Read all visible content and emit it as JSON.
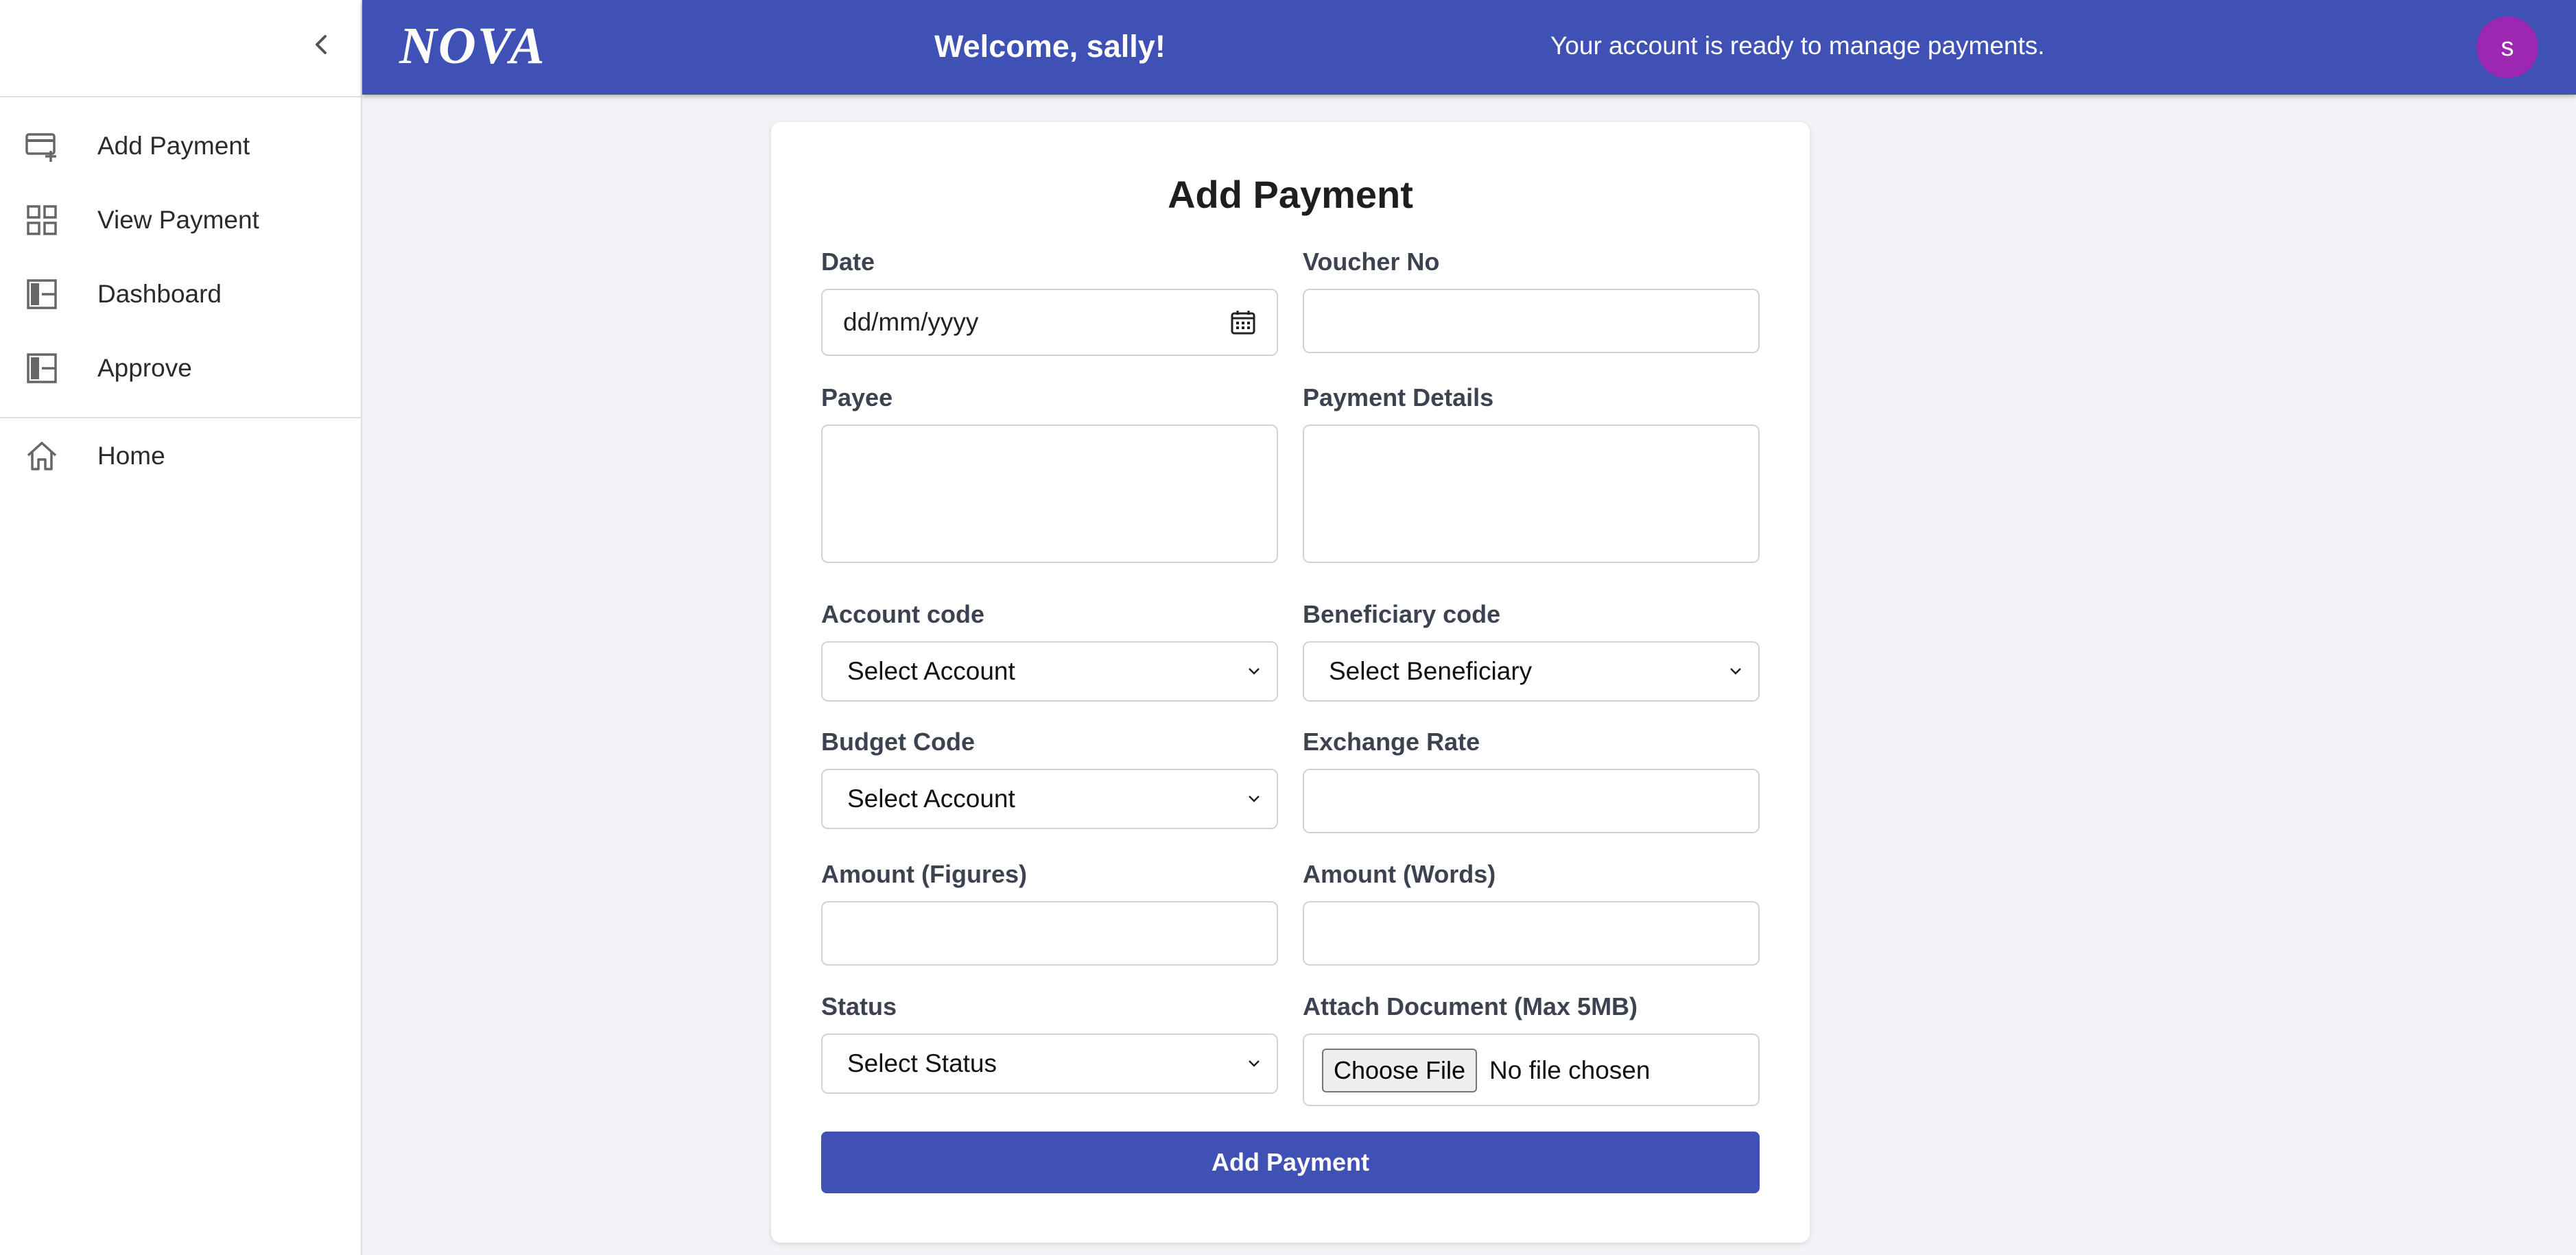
{
  "sidebar": {
    "collapse_icon": "chevron-left-icon",
    "items": [
      {
        "label": "Add Payment",
        "icon": "card-plus-icon"
      },
      {
        "label": "View Payment",
        "icon": "grid-icon"
      },
      {
        "label": "Dashboard",
        "icon": "dashboard-icon"
      },
      {
        "label": "Approve",
        "icon": "dashboard-icon"
      },
      {
        "label": "Home",
        "icon": "home-icon"
      }
    ]
  },
  "header": {
    "logo": "NOVA",
    "welcome": "Welcome, sally!",
    "status": "Your account is ready to manage payments.",
    "avatar_initial": "s",
    "bg_color": "#3f51b5",
    "avatar_color": "#9c27b0"
  },
  "form": {
    "title": "Add Payment",
    "date": {
      "label": "Date",
      "placeholder": "dd/mm/yyyy"
    },
    "voucher": {
      "label": "Voucher No",
      "value": ""
    },
    "payee": {
      "label": "Payee",
      "value": ""
    },
    "payment_details": {
      "label": "Payment Details",
      "value": ""
    },
    "account_code": {
      "label": "Account code",
      "selected": "Select Account"
    },
    "beneficiary_code": {
      "label": "Beneficiary code",
      "selected": "Select Beneficiary"
    },
    "budget_code": {
      "label": "Budget Code",
      "selected": "Select Account"
    },
    "exchange_rate": {
      "label": "Exchange Rate",
      "value": ""
    },
    "amount_figures": {
      "label": "Amount (Figures)",
      "value": ""
    },
    "amount_words": {
      "label": "Amount (Words)",
      "value": ""
    },
    "status": {
      "label": "Status",
      "selected": "Select Status"
    },
    "attach": {
      "label": "Attach Document (Max 5MB)",
      "button": "Choose File",
      "file_text": "No file chosen"
    },
    "submit_label": "Add Payment"
  }
}
